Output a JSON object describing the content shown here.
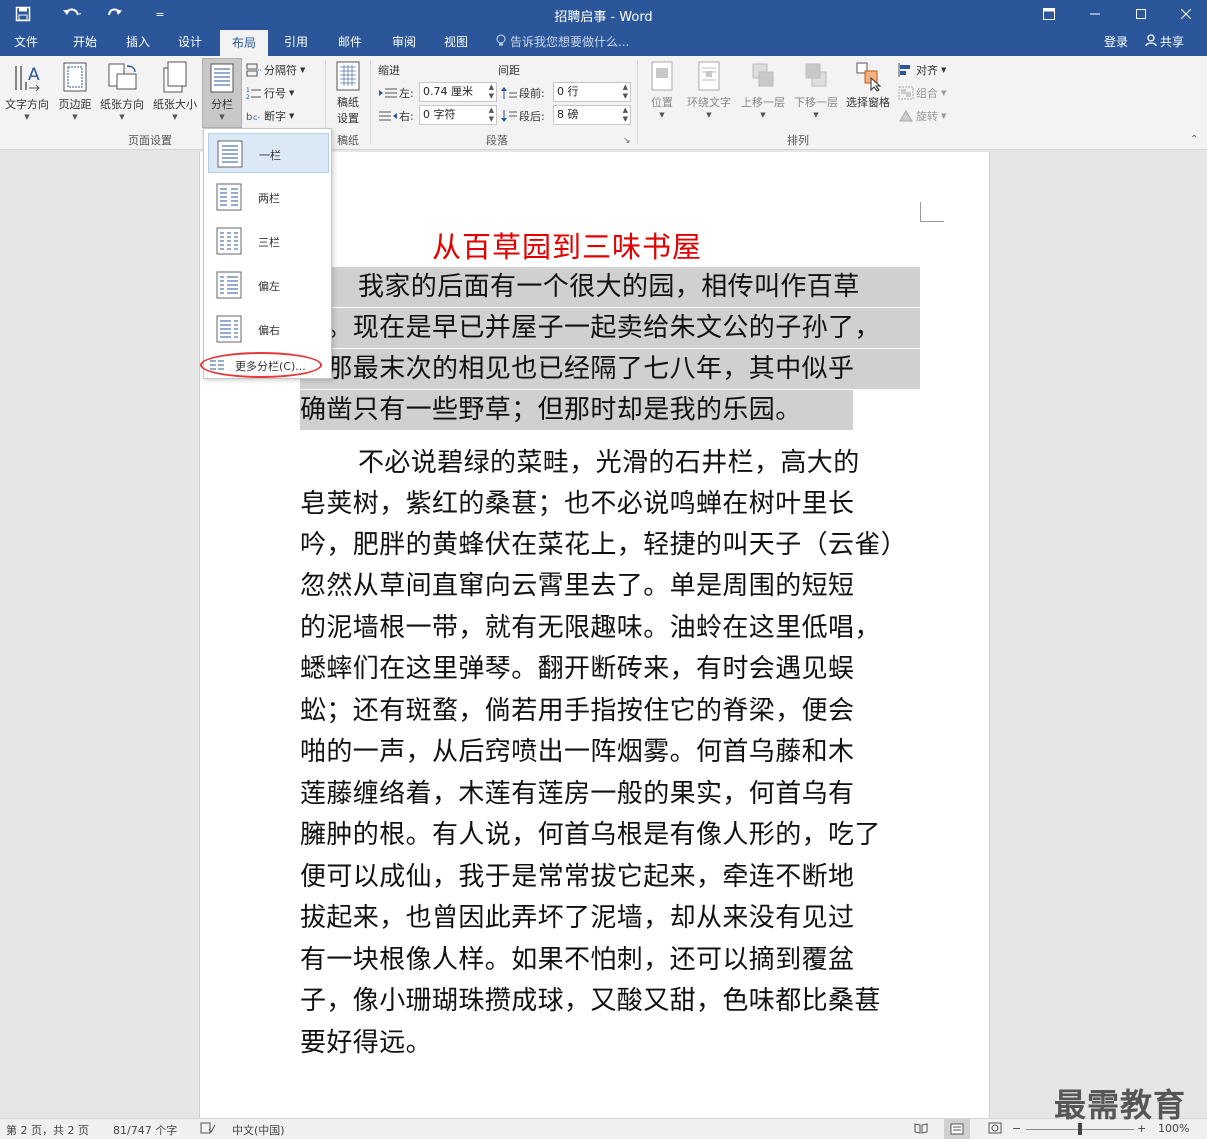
{
  "window": {
    "title": "招聘启事 - Word"
  },
  "tabs": [
    "文件",
    "开始",
    "插入",
    "设计",
    "布局",
    "引用",
    "邮件",
    "审阅",
    "视图"
  ],
  "tell_me": "告诉我您想要做什么...",
  "account": {
    "login": "登录",
    "share": "共享"
  },
  "ribbon": {
    "page_setup": {
      "text_direction": "文字方向",
      "margins": "页边距",
      "orientation": "纸张方向",
      "size": "纸张大小",
      "columns": "分栏",
      "breaks": "分隔符",
      "line_numbers": "行号",
      "hyphenation": "断字",
      "group": "页面设置"
    },
    "draft": {
      "label": "稿纸",
      "label2": "设置",
      "group": "稿纸"
    },
    "paragraph": {
      "indent_title": "缩进",
      "spacing_title": "间距",
      "left_label": "左:",
      "left_value": "0.74 厘米",
      "right_label": "右:",
      "right_value": "0 字符",
      "before_label": "段前:",
      "before_value": "0 行",
      "after_label": "段后:",
      "after_value": "8 磅",
      "group": "段落"
    },
    "arrange": {
      "position": "位置",
      "wrap": "环绕文字",
      "forward": "上移一层",
      "backward": "下移一层",
      "selection_pane": "选择窗格",
      "align": "对齐",
      "group_btn": "组合",
      "rotate": "旋转",
      "group": "排列"
    }
  },
  "columns_menu": {
    "items": [
      "一栏",
      "两栏",
      "三栏",
      "偏左",
      "偏右"
    ],
    "more": "更多分栏(C)..."
  },
  "document": {
    "title": "从百草园到三味书屋",
    "lines": [
      "我家的后面有一个很大的园，相传叫作百草",
      "园。现在是早已并屋子一起卖给朱文公的子孙了，",
      "连那最末次的相见也已经隔了七八年，其中似乎",
      "确凿只有一些野草；但那时却是我的乐园。",
      "不必说碧绿的菜畦，光滑的石井栏，高大的",
      "皂荚树，紫红的桑葚；也不必说鸣蝉在树叶里长",
      "吟，肥胖的黄蜂伏在菜花上，轻捷的叫天子（云雀）",
      "忽然从草间直窜向云霄里去了。单是周围的短短",
      "的泥墙根一带，就有无限趣味。油蛉在这里低唱，",
      "蟋蟀们在这里弹琴。翻开断砖来，有时会遇见蜈",
      "蚣；还有斑蝥，倘若用手指按住它的脊梁，便会",
      "啪的一声，从后窍喷出一阵烟雾。何首乌藤和木",
      "莲藤缠络着，木莲有莲房一般的果实，何首乌有",
      "臃肿的根。有人说，何首乌根是有像人形的，吃了",
      "便可以成仙，我于是常常拔它起来，牵连不断地",
      "拔起来，也曾因此弄坏了泥墙，却从来没有见过",
      "有一块根像人样。如果不怕刺，还可以摘到覆盆",
      "子，像小珊瑚珠攒成球，又酸又甜，色味都比桑葚",
      "要好得远。"
    ]
  },
  "status": {
    "page": "第 2 页，共 2 页",
    "words": "81/747 个字",
    "lang": "中文(中国)",
    "zoom": "100%"
  },
  "watermark": "最需教育",
  "colors": {
    "brand": "#2b579a",
    "title_red": "#e00000",
    "highlight": "#d0d0d0",
    "annotation": "#e23a3a"
  }
}
